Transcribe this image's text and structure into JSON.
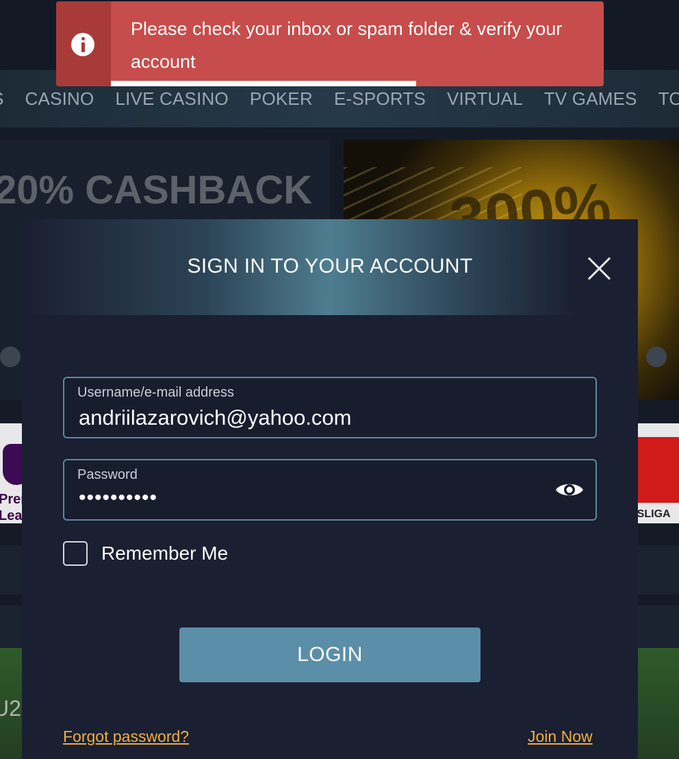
{
  "nav": {
    "items": [
      "S",
      "CASINO",
      "LIVE CASINO",
      "POKER",
      "E-SPORTS",
      "VIRTUAL",
      "TV GAMES",
      "TOU"
    ]
  },
  "promos": {
    "left_headline": "20% CASHBACK",
    "right_headline": "300%"
  },
  "leagues": {
    "left_line1": "Prem",
    "left_line2": "Lea",
    "right_text": "ESLIGA"
  },
  "background_labels": {
    "pitch_label": "U2"
  },
  "toast": {
    "message": "Please check your inbox or spam folder & verify your account",
    "icon": "info-icon",
    "progress_remaining": 0.62
  },
  "login_modal": {
    "title": "SIGN IN TO YOUR ACCOUNT",
    "username_label": "Username/e-mail address",
    "username_value": "andriilazarovich@yahoo.com",
    "password_label": "Password",
    "password_masked": "••••••••••",
    "remember_label": "Remember Me",
    "remember_checked": false,
    "login_button": "LOGIN",
    "forgot_link": "Forgot password?",
    "join_link": "Join Now"
  },
  "colors": {
    "toast_bg": "#c64d4b",
    "login_button_bg": "#5b8ea8",
    "link_color": "#f0b03b",
    "modal_bg": "#1a1f31"
  }
}
